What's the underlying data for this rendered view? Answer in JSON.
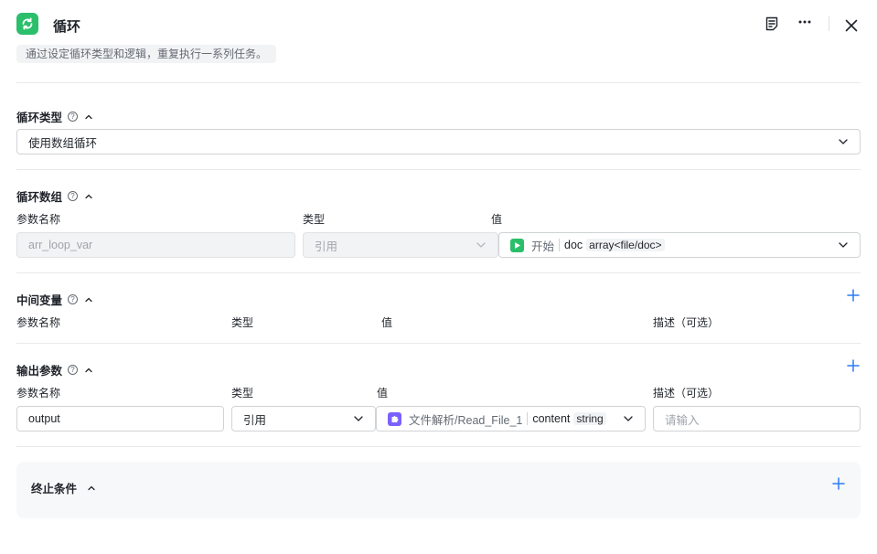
{
  "header": {
    "title": "循环",
    "description": "通过设定循环类型和逻辑，重复执行一系列任务。",
    "icons": {
      "logo": "loop-refresh-icon",
      "notes": "notes-icon",
      "more": "more-icon",
      "close": "close-icon"
    }
  },
  "loop_type": {
    "title": "循环类型",
    "help": "?",
    "value": "使用数组循环"
  },
  "loop_array": {
    "title": "循环数组",
    "help": "?",
    "col_name": "参数名称",
    "col_type": "类型",
    "col_value": "值",
    "row": {
      "name": "arr_loop_var",
      "type": "引用",
      "source": "开始",
      "field": "doc",
      "field_type": "array<file/doc>"
    }
  },
  "intermediate": {
    "title": "中间变量",
    "help": "?",
    "col_name": "参数名称",
    "col_type": "类型",
    "col_value": "值",
    "col_desc": "描述（可选）"
  },
  "output": {
    "title": "输出参数",
    "help": "?",
    "col_name": "参数名称",
    "col_type": "类型",
    "col_value": "值",
    "col_desc": "描述（可选）",
    "row": {
      "name": "output",
      "type": "引用",
      "source": "文件解析/Read_File_1",
      "field": "content",
      "field_type": "string",
      "desc_placeholder": "请输入"
    }
  },
  "end_condition": {
    "title": "终止条件"
  },
  "colors": {
    "accent": "#2b7bf6",
    "green": "#2bbf6b",
    "purple": "#7b61ff"
  }
}
